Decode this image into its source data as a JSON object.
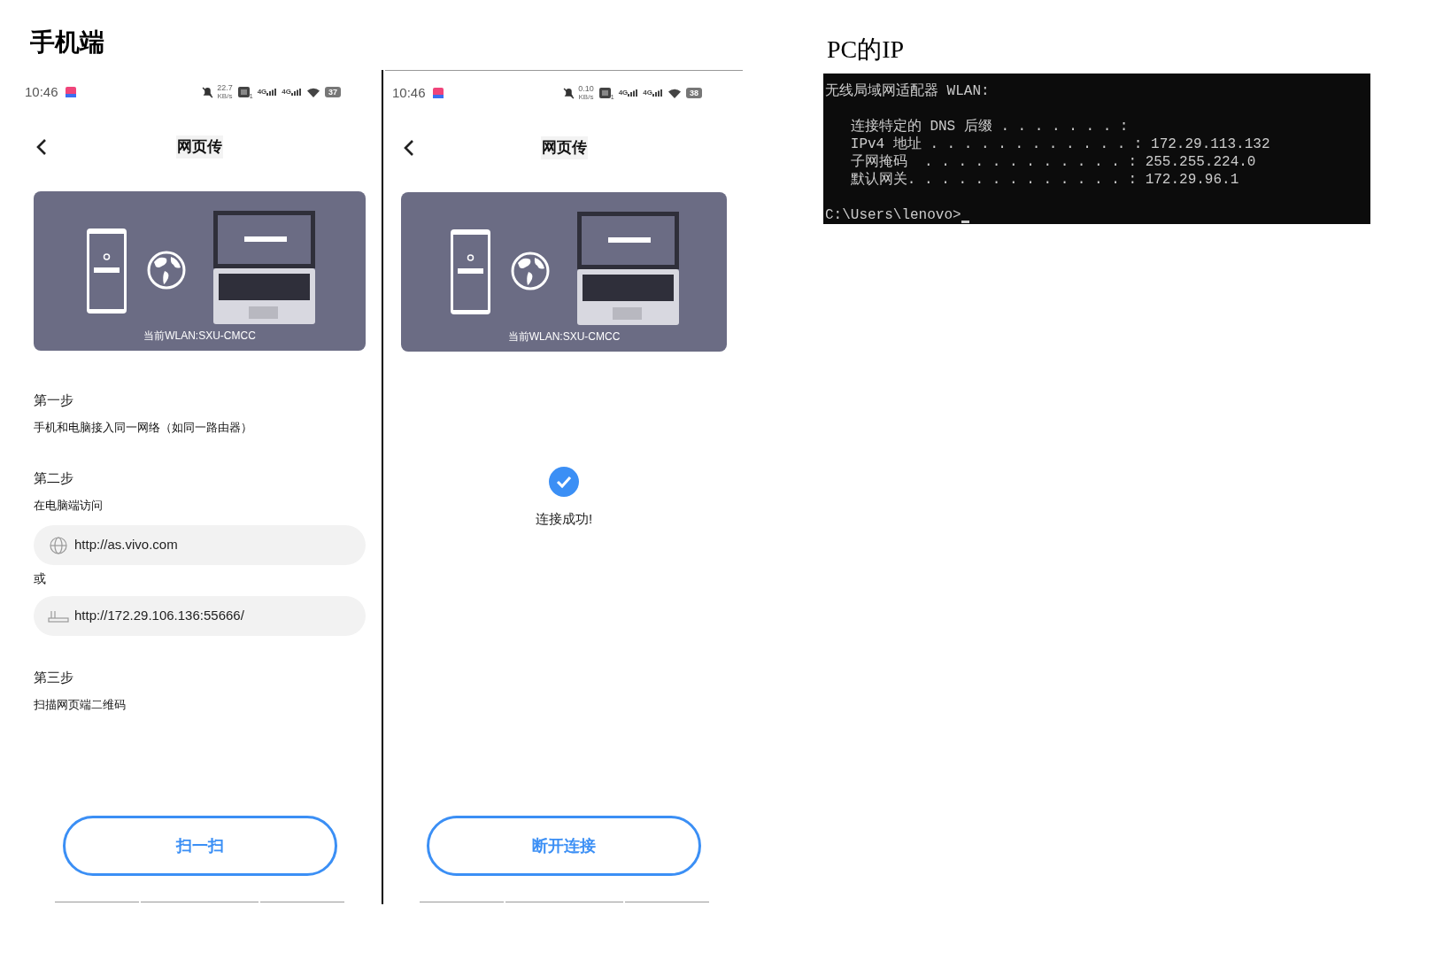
{
  "left_heading": "手机端",
  "right_heading": "PC的IP",
  "phones": [
    {
      "kind": "steps",
      "status": {
        "time": "10:46",
        "speed": "22.7",
        "speed_unit": "KB/s",
        "sim": "1",
        "network": [
          "4G",
          "4G"
        ],
        "battery": "37"
      },
      "title": "网页传",
      "card_caption": "当前WLAN:SXU-CMCC",
      "steps": [
        {
          "title": "第一步",
          "text": "手机和电脑接入同一网络（如同一路由器）"
        },
        {
          "title": "第二步",
          "text": "在电脑端访问",
          "urls": [
            {
              "kind": "globe",
              "url": "http://as.vivo.com"
            },
            {
              "kind": "router",
              "url": "http://172.29.106.136:55666/"
            }
          ],
          "separator": "或"
        },
        {
          "title": "第三步",
          "text": "扫描网页端二维码"
        }
      ],
      "button": "扫一扫"
    },
    {
      "kind": "connected",
      "status": {
        "time": "10:46",
        "speed": "0.10",
        "speed_unit": "KB/s",
        "sim": "1",
        "network": [
          "4G",
          "4G"
        ],
        "battery": "38"
      },
      "title": "网页传",
      "card_caption": "当前WLAN:SXU-CMCC",
      "success": "连接成功!",
      "button": "断开连接"
    }
  ],
  "terminal": {
    "blocks": [
      [
        "无线局域网适配器 WLAN:"
      ],
      [
        "   连接特定的 DNS 后缀 . . . . . . . :",
        "   IPv4 地址 . . . . . . . . . . . . : 172.29.113.132",
        "   子网掩码  . . . . . . . . . . . . : 255.255.224.0",
        "   默认网关. . . . . . . . . . . . . : 172.29.96.1"
      ]
    ],
    "prompt": "C:\\Users\\lenovo>"
  }
}
